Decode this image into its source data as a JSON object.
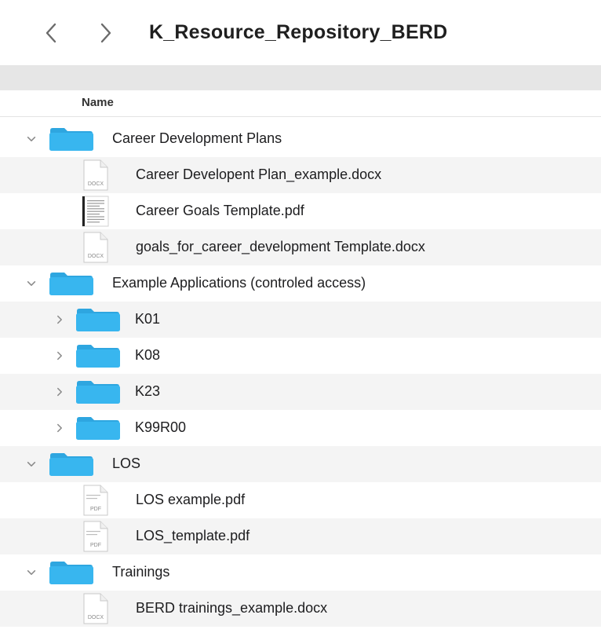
{
  "window": {
    "title": "K_Resource_Repository_BERD",
    "back_icon": "chevron-left-icon",
    "forward_icon": "chevron-right-icon"
  },
  "columns": {
    "name": "Name"
  },
  "colors": {
    "folder": "#38b6ef",
    "folder_tab": "#2ea6e0",
    "stripe": "#f4f4f4"
  },
  "rows": [
    {
      "type": "folder",
      "level": 0,
      "expanded": true,
      "name": "Career Development Plans"
    },
    {
      "type": "file",
      "level": 1,
      "icon": "docx-file-icon",
      "badge": "DOCX",
      "name": "Career Developent Plan_example.docx"
    },
    {
      "type": "file",
      "level": 1,
      "icon": "pdf-preview-icon",
      "badge": "",
      "name": "Career Goals Template.pdf"
    },
    {
      "type": "file",
      "level": 1,
      "icon": "docx-file-icon",
      "badge": "DOCX",
      "name": "goals_for_career_development Template.docx"
    },
    {
      "type": "folder",
      "level": 0,
      "expanded": true,
      "name": "Example Applications (controled access)"
    },
    {
      "type": "folder",
      "level": 1,
      "expanded": false,
      "name": "K01"
    },
    {
      "type": "folder",
      "level": 1,
      "expanded": false,
      "name": "K08"
    },
    {
      "type": "folder",
      "level": 1,
      "expanded": false,
      "name": "K23"
    },
    {
      "type": "folder",
      "level": 1,
      "expanded": false,
      "name": "K99R00"
    },
    {
      "type": "folder",
      "level": 0,
      "expanded": true,
      "name": "LOS"
    },
    {
      "type": "file",
      "level": 1,
      "icon": "pdf-file-icon",
      "badge": "PDF",
      "name": "LOS example.pdf"
    },
    {
      "type": "file",
      "level": 1,
      "icon": "pdf-file-icon",
      "badge": "PDF",
      "name": "LOS_template.pdf"
    },
    {
      "type": "folder",
      "level": 0,
      "expanded": true,
      "name": "Trainings"
    },
    {
      "type": "file",
      "level": 1,
      "icon": "docx-file-icon",
      "badge": "DOCX",
      "name": "BERD trainings_example.docx"
    }
  ]
}
